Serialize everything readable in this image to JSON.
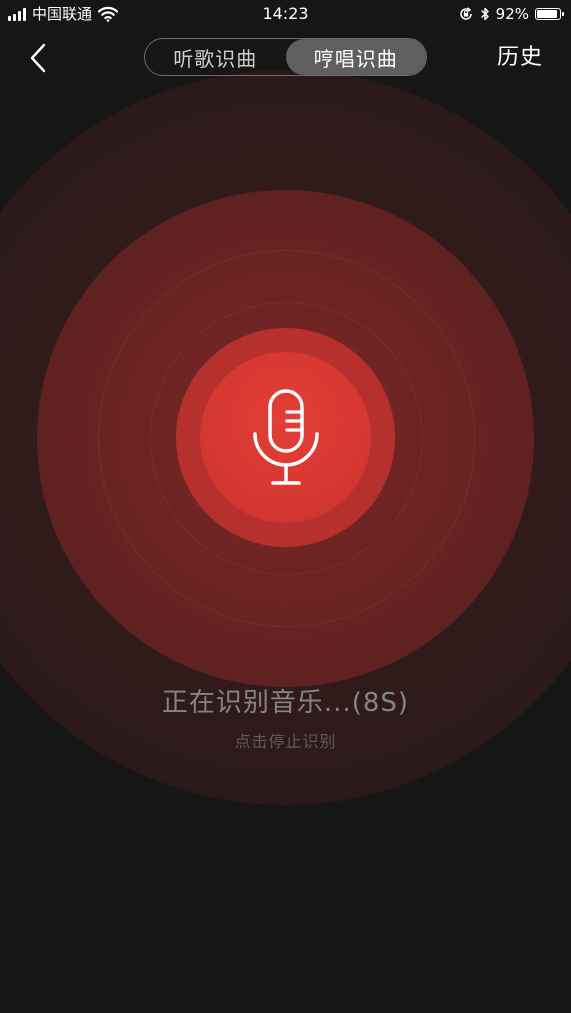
{
  "status_bar": {
    "carrier": "中国联通",
    "time": "14:23",
    "battery_percent": "92%",
    "battery_level": 0.92,
    "icons": [
      "signal-icon",
      "wifi-icon",
      "orientation-lock-icon",
      "bluetooth-icon",
      "battery-icon"
    ]
  },
  "nav": {
    "back_icon": "chevron-left-icon",
    "tabs": [
      {
        "label": "听歌识曲",
        "active": false
      },
      {
        "label": "哼唱识曲",
        "active": true
      }
    ],
    "history_label": "历史"
  },
  "main": {
    "mic_icon": "microphone-icon",
    "status_text": "正在识别音乐...(8S)",
    "hint_text": "点击停止识别"
  },
  "colors": {
    "background": "#161616",
    "accent": "#d53731",
    "segment_active": "#5f5f5f"
  }
}
